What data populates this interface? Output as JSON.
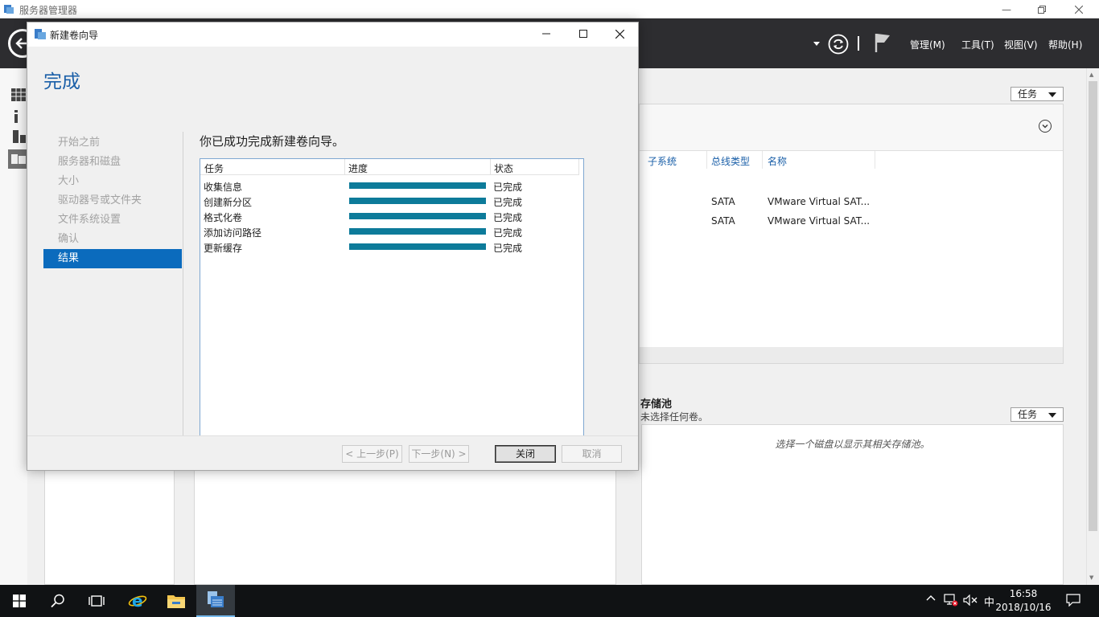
{
  "server_manager": {
    "title": "服务器管理器",
    "menu": {
      "manage": "管理(M)",
      "tools": "工具(T)",
      "view": "视图(V)",
      "help": "帮助(H)"
    },
    "disk_panel": {
      "tasks_label": "任务",
      "columns": [
        "子系统",
        "总线类型",
        "名称"
      ],
      "rows": [
        {
          "subsystem": "",
          "bus": "SATA",
          "name": "VMware Virtual SAT..."
        },
        {
          "subsystem": "",
          "bus": "SATA",
          "name": "VMware Virtual SAT..."
        }
      ]
    },
    "storage_pool": {
      "title": "存储池",
      "subtitle": "未选择任何卷。",
      "tasks_label": "任务",
      "hint": "选择一个磁盘以显示其相关存储池。"
    }
  },
  "wizard": {
    "window_title": "新建卷向导",
    "page_title": "完成",
    "steps": [
      {
        "label": "开始之前",
        "active": false
      },
      {
        "label": "服务器和磁盘",
        "active": false
      },
      {
        "label": "大小",
        "active": false
      },
      {
        "label": "驱动器号或文件夹",
        "active": false
      },
      {
        "label": "文件系统设置",
        "active": false
      },
      {
        "label": "确认",
        "active": false
      },
      {
        "label": "结果",
        "active": true
      }
    ],
    "heading": "你已成功完成新建卷向导。",
    "table": {
      "headers": {
        "task": "任务",
        "progress": "进度",
        "status": "状态"
      },
      "rows": [
        {
          "task": "收集信息",
          "progress": 1.0,
          "status": "已完成"
        },
        {
          "task": "创建新分区",
          "progress": 1.0,
          "status": "已完成"
        },
        {
          "task": "格式化卷",
          "progress": 1.0,
          "status": "已完成"
        },
        {
          "task": "添加访问路径",
          "progress": 1.0,
          "status": "已完成"
        },
        {
          "task": "更新缓存",
          "progress": 1.0,
          "status": "已完成"
        }
      ]
    },
    "buttons": {
      "prev": "< 上一步(P)",
      "next": "下一步(N) >",
      "close": "关闭",
      "cancel": "取消"
    }
  },
  "taskbar": {
    "ime": "中",
    "time": "16:58",
    "date": "2018/10/16"
  },
  "colors": {
    "accent_blue": "#0b6bbd",
    "progress_fill": "#0d7b9a",
    "header_dark": "#2d2d30",
    "taskbar": "#101214"
  }
}
